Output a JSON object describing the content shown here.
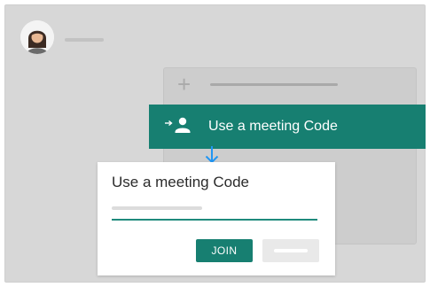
{
  "header": {
    "avatar_icon": "user-avatar-icon"
  },
  "background_card": {
    "add_icon": "plus-icon"
  },
  "menu_item": {
    "label": "Use a meeting Code",
    "icon": "enter-user-icon",
    "accent": "#177f71"
  },
  "dialog": {
    "title": "Use a meeting Code",
    "code_field": {
      "value": "",
      "placeholder": ""
    },
    "join_label": "JOIN",
    "cancel_label": ""
  },
  "colors": {
    "teal": "#177f71",
    "arrow_blue": "#2196f3",
    "backdrop": "#d7d7d7"
  }
}
